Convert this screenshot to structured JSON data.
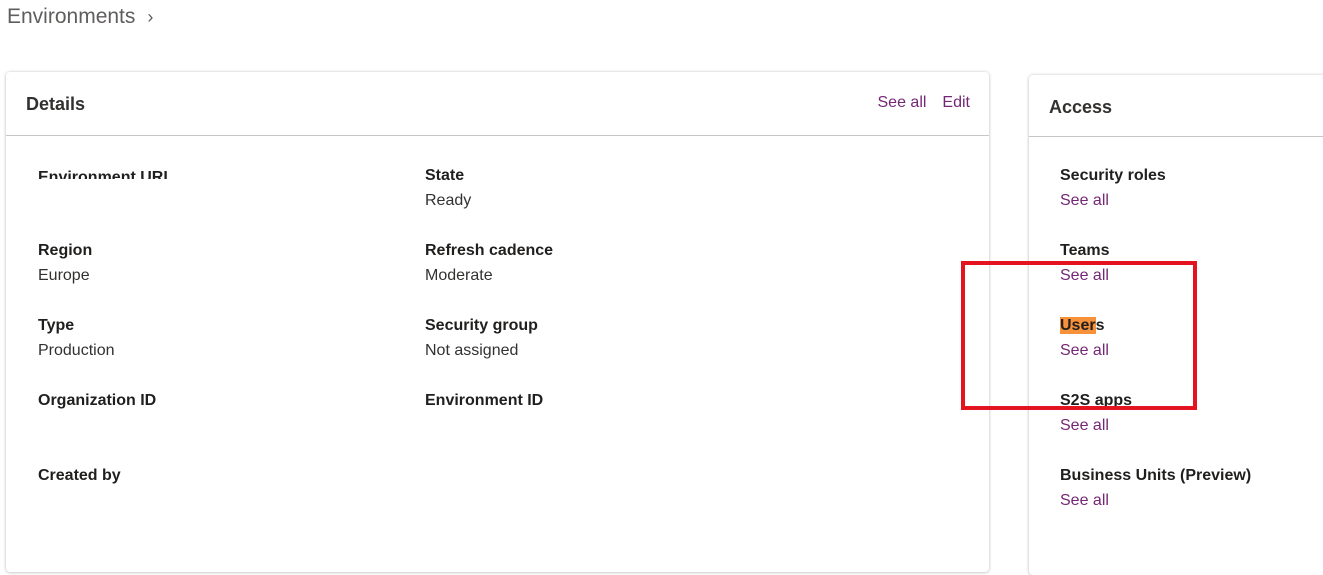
{
  "breadcrumb": {
    "label": "Environments",
    "chevron_icon": "chevron-right-icon"
  },
  "details": {
    "title": "Details",
    "see_all": "See all",
    "edit": "Edit",
    "fields": [
      {
        "label": "Environment URL",
        "value": ""
      },
      {
        "label": "State",
        "value": "Ready"
      },
      {
        "label": "Region",
        "value": "Europe"
      },
      {
        "label": "Refresh cadence",
        "value": "Moderate"
      },
      {
        "label": "Type",
        "value": "Production"
      },
      {
        "label": "Security group",
        "value": "Not assigned"
      },
      {
        "label": "Organization ID",
        "value": ""
      },
      {
        "label": "Environment ID",
        "value": ""
      },
      {
        "label": "Created by",
        "value": ""
      }
    ]
  },
  "access": {
    "title": "Access",
    "items": [
      {
        "label": "Security roles",
        "link": "See all"
      },
      {
        "label": "Teams",
        "link": "See all"
      },
      {
        "label_highlighted": "User",
        "label_rest": "s",
        "link": "See all"
      },
      {
        "label": "S2S apps",
        "link": "See all"
      },
      {
        "label": "Business Units (Preview)",
        "link": "See all"
      }
    ]
  },
  "colors": {
    "link": "#742774",
    "highlight": "#f7923a",
    "annotation_box": "#e3131f"
  }
}
